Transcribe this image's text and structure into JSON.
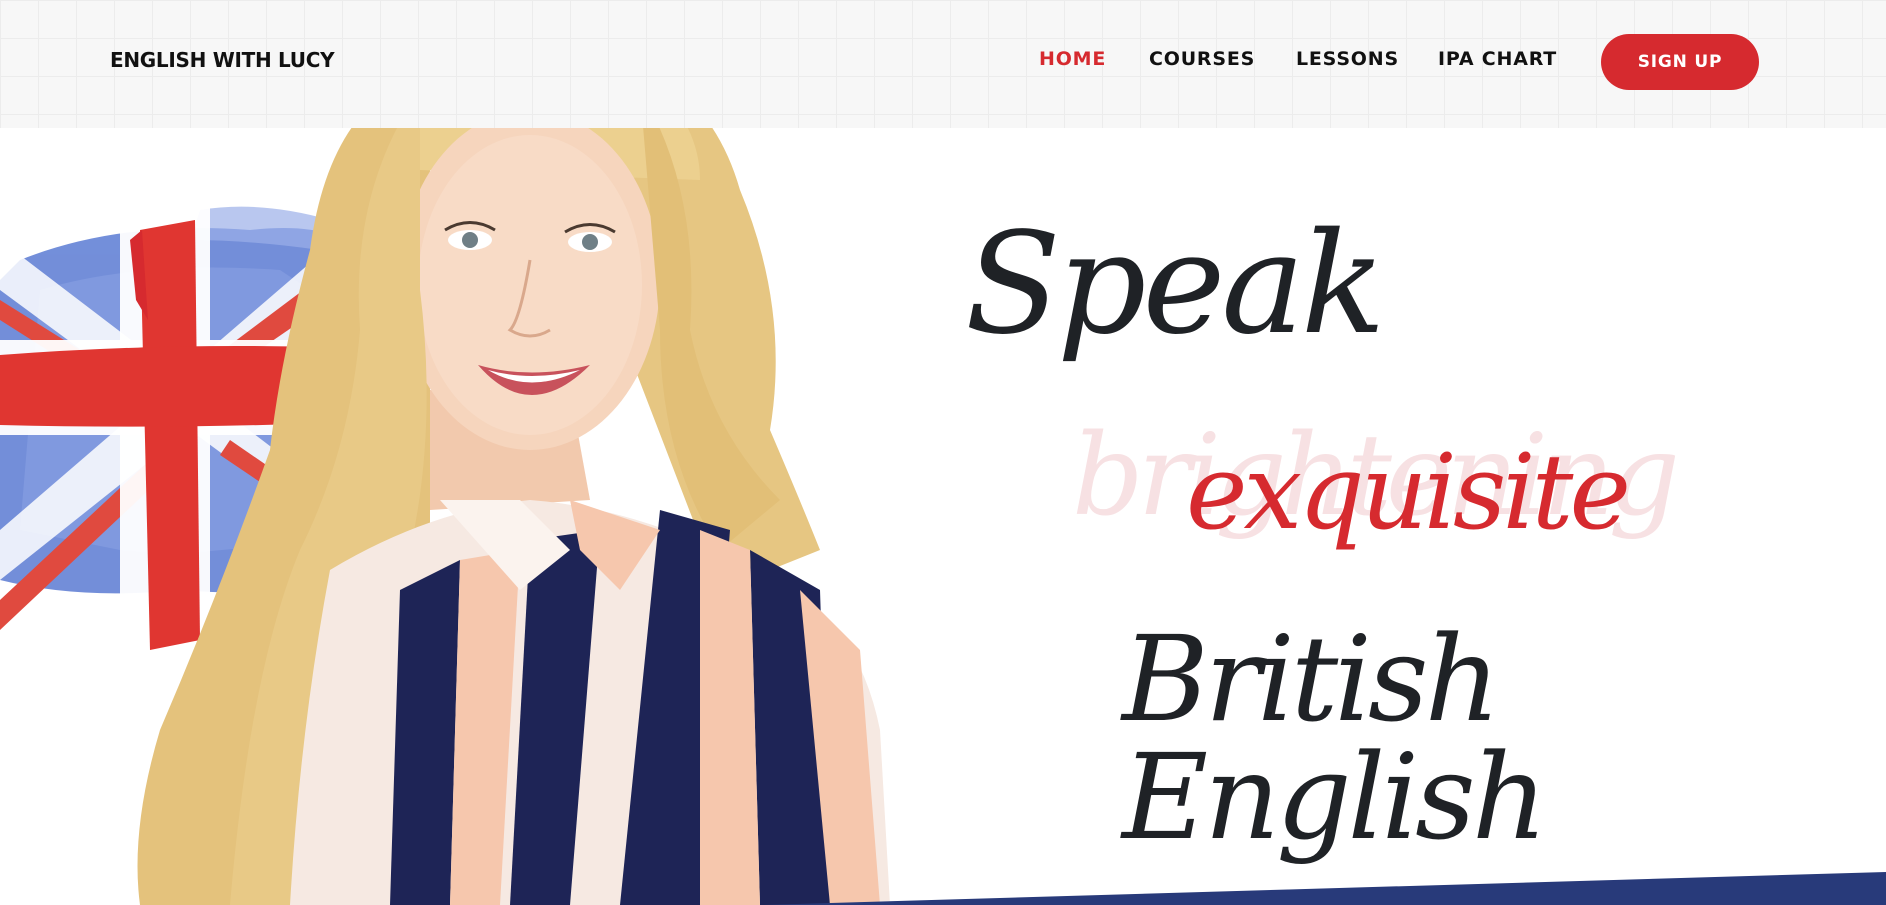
{
  "header": {
    "logo": "ENGLISH WITH LUCY",
    "nav": [
      {
        "label": "HOME",
        "active": true
      },
      {
        "label": "COURSES",
        "active": false
      },
      {
        "label": "LESSONS",
        "active": false
      },
      {
        "label": "IPA CHART",
        "active": false
      }
    ],
    "signup_label": "SIGN UP"
  },
  "hero": {
    "line1": "Speak",
    "line2": "exquisite",
    "line2_ghost": "brightening",
    "line3": "British English"
  },
  "colors": {
    "accent_red": "#d62a2f",
    "text_dark": "#1f2226",
    "navy": "#283a7a"
  },
  "icons": [
    "union-jack-flag",
    "portrait-photo"
  ]
}
